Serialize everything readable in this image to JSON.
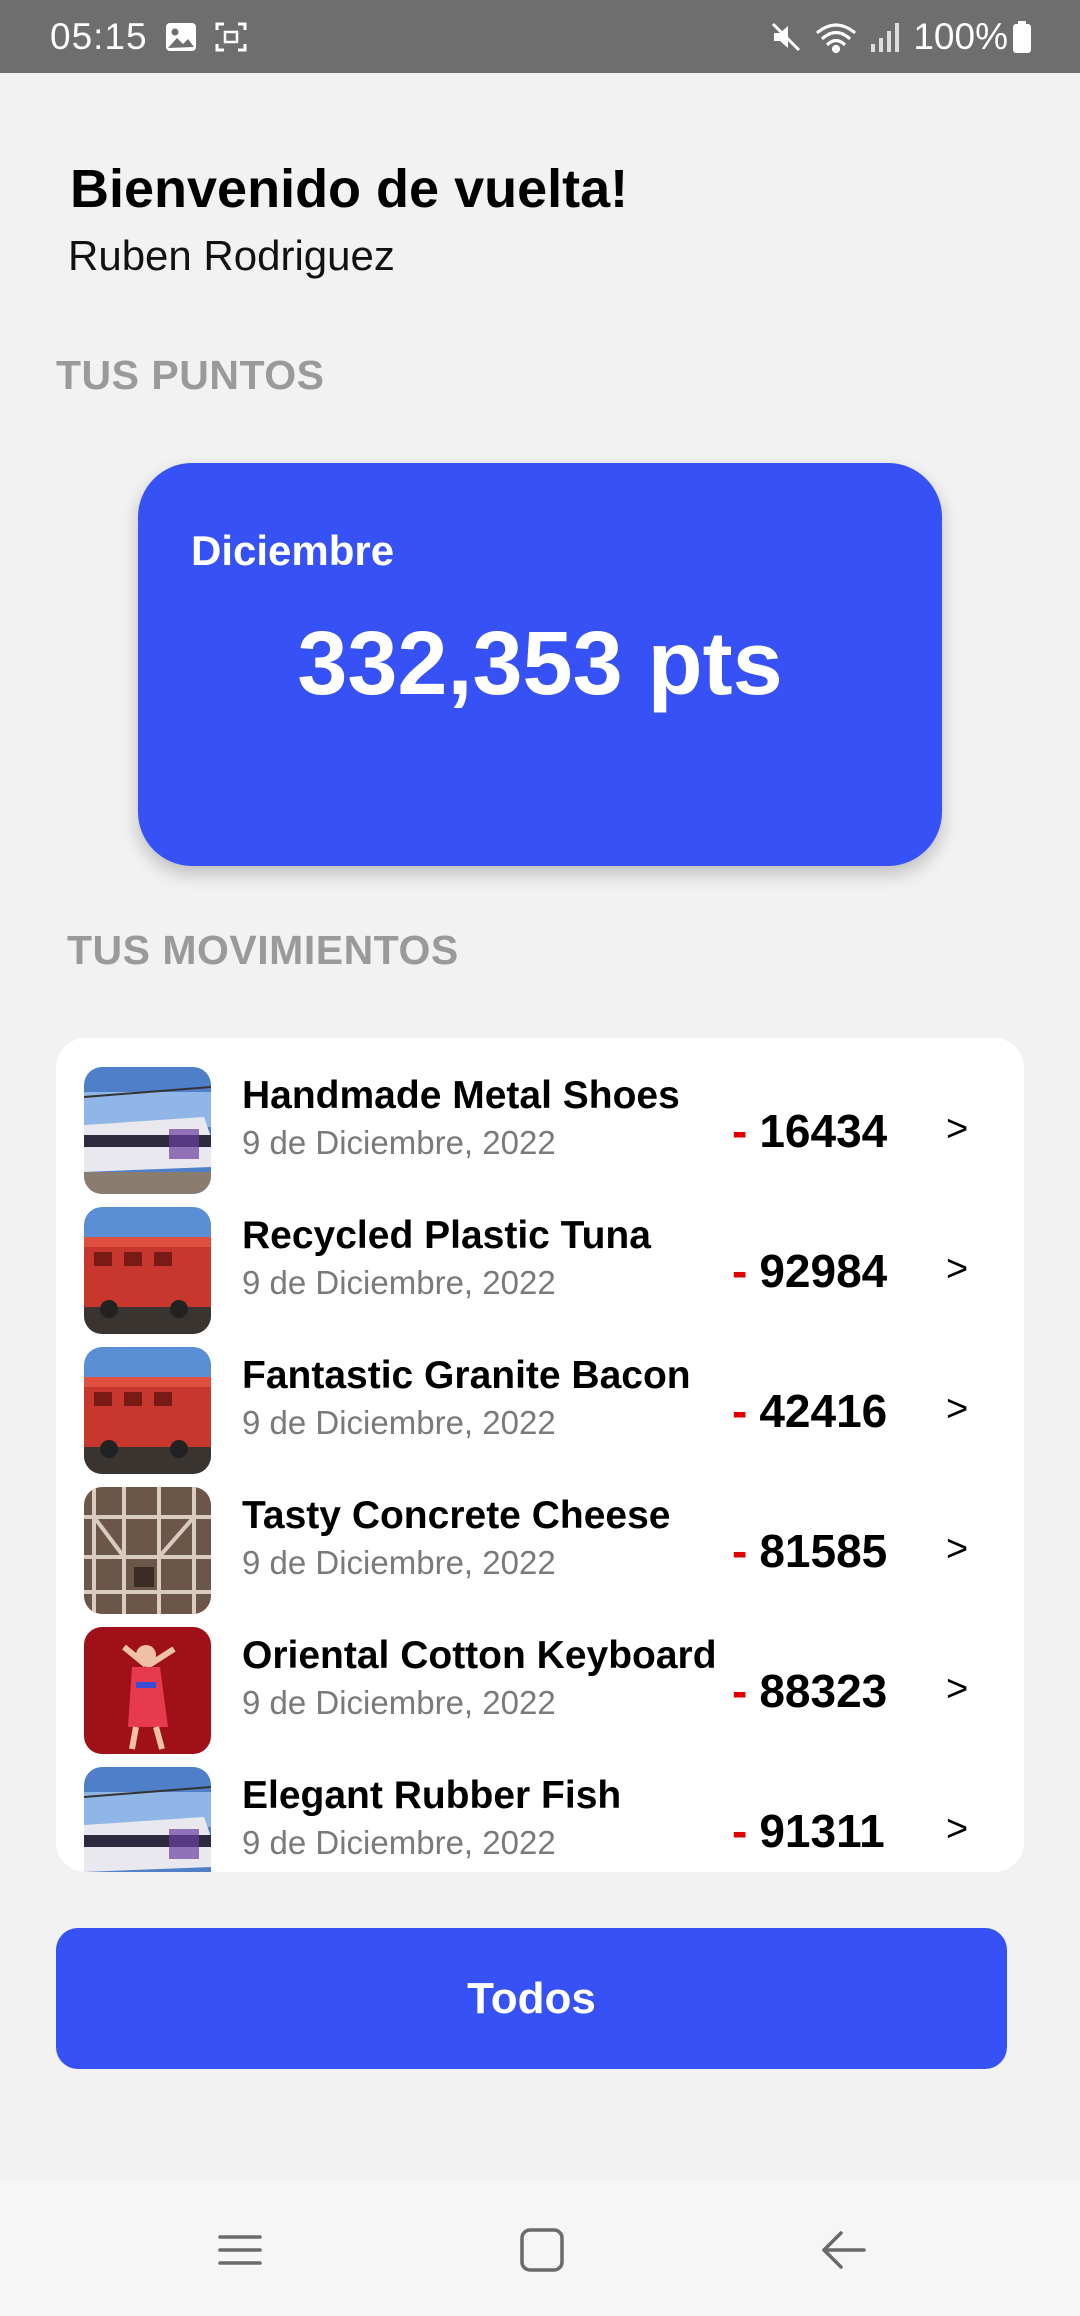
{
  "status_bar": {
    "time": "05:15",
    "battery": "100%",
    "icons_left": [
      "image-icon",
      "screenshot-icon"
    ],
    "icons_right": [
      "mute-icon",
      "wifi-icon",
      "signal-icon",
      "battery-icon"
    ]
  },
  "header": {
    "greeting": "Bienvenido de vuelta!",
    "user_name": "Ruben Rodriguez"
  },
  "points": {
    "section_label": "TUS PUNTOS",
    "month": "Diciembre",
    "value": "332,353 pts",
    "card_color": "#3651f5"
  },
  "movements": {
    "section_label": "TUS MOVIMIENTOS",
    "items": [
      {
        "title": "Handmade Metal Shoes",
        "date": "9 de Diciembre, 2022",
        "sign": "-",
        "amount": "16434",
        "chevron": ">",
        "thumb": "white-train"
      },
      {
        "title": "Recycled Plastic Tuna",
        "date": "9 de Diciembre, 2022",
        "sign": "-",
        "amount": "92984",
        "chevron": ">",
        "thumb": "red-locomotive"
      },
      {
        "title": "Fantastic Granite Bacon",
        "date": "9 de Diciembre, 2022",
        "sign": "-",
        "amount": "42416",
        "chevron": ">",
        "thumb": "red-locomotive"
      },
      {
        "title": "Tasty Concrete Cheese",
        "date": "9 de Diciembre, 2022",
        "sign": "-",
        "amount": "81585",
        "chevron": ">",
        "thumb": "industrial-structure"
      },
      {
        "title": "Oriental Cotton Keyboard",
        "date": "9 de Diciembre, 2022",
        "sign": "-",
        "amount": "88323",
        "chevron": ">",
        "thumb": "dancer-red"
      },
      {
        "title": "Elegant Rubber Fish",
        "date": "9 de Diciembre, 2022",
        "sign": "-",
        "amount": "91311",
        "chevron": ">",
        "thumb": "white-train"
      }
    ]
  },
  "button": {
    "label": "Todos",
    "color": "#3651f5"
  },
  "colors": {
    "negative": "#e00000",
    "label_gray": "#9a9a9a"
  },
  "nav_bar": {
    "icons": [
      "recents-icon",
      "home-icon",
      "back-icon"
    ]
  }
}
